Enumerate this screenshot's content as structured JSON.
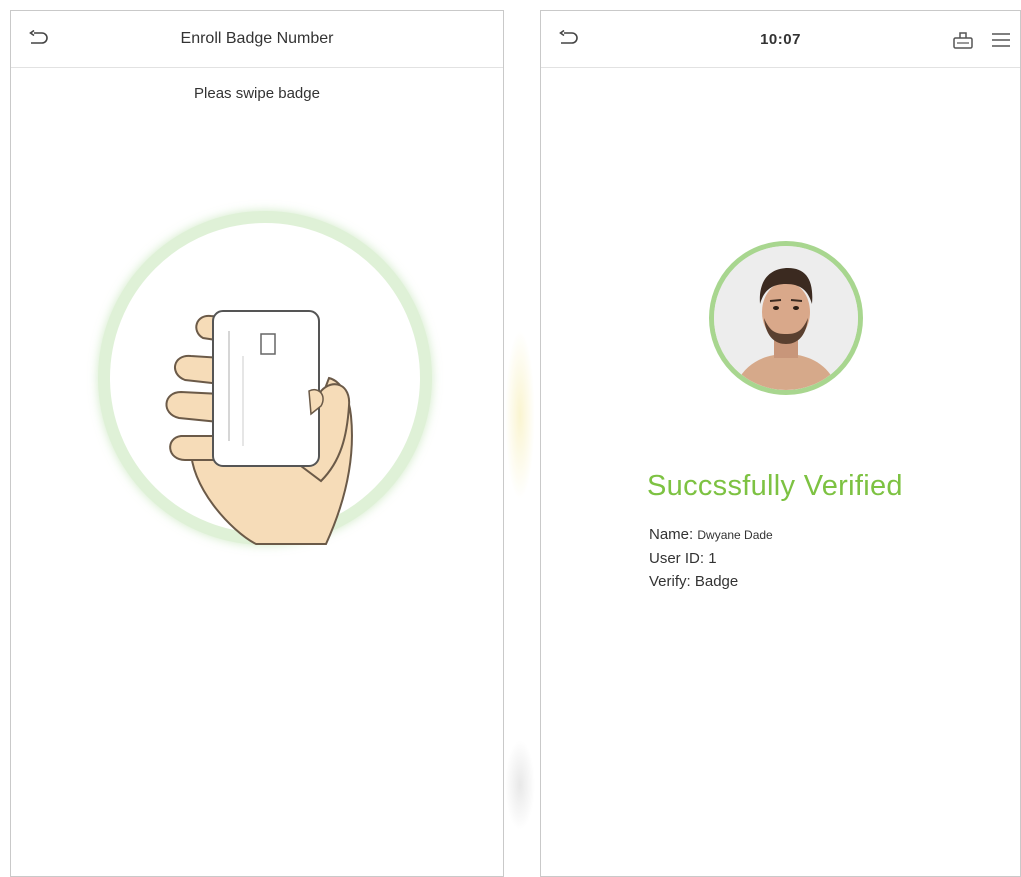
{
  "left_screen": {
    "title": "Enroll Badge Number",
    "prompt": "Pleas swipe badge",
    "back_icon": "back-arrow-icon",
    "illustration": "hand-holding-badge"
  },
  "right_screen": {
    "time": "10:07",
    "back_icon": "back-arrow-icon",
    "icons": [
      "attendance-device-icon",
      "menu-icon"
    ],
    "status": "Succssfully  Verified",
    "name_label": "Name:",
    "name_value": "Dwyane Dade",
    "user_id_label": "User ID:",
    "user_id_value": "1",
    "verify_label": "Verify:",
    "verify_value": "Badge"
  },
  "colors": {
    "success_green": "#7dc242",
    "ring_green": "#dff1d7",
    "avatar_ring": "#a8d68f",
    "text": "#333333",
    "border": "#c9c9c9"
  }
}
